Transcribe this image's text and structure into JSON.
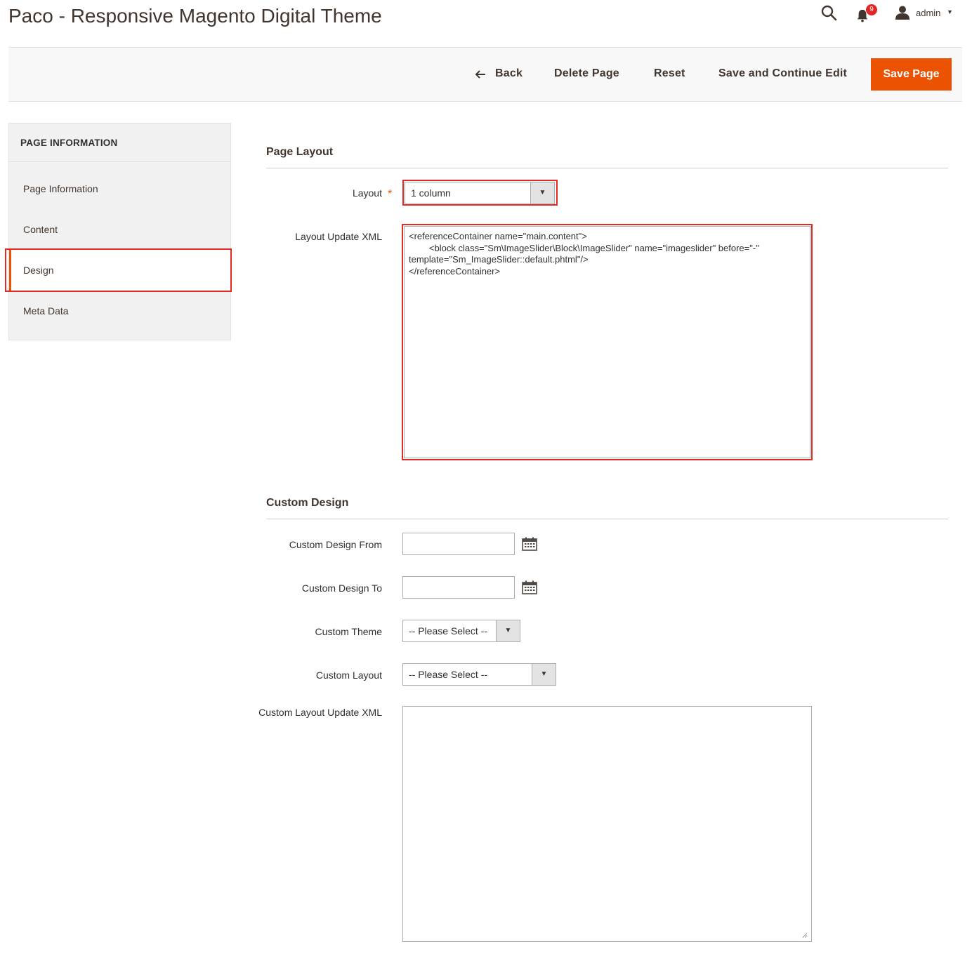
{
  "header": {
    "title": "Paco - Responsive Magento Digital Theme",
    "notifications_count": "9",
    "user_name": "admin"
  },
  "actions": {
    "back_label": "Back",
    "delete_label": "Delete Page",
    "reset_label": "Reset",
    "save_continue_label": "Save and Continue Edit",
    "save_label": "Save Page"
  },
  "sidebar": {
    "title": "PAGE INFORMATION",
    "items": [
      {
        "label": "Page Information",
        "active": false
      },
      {
        "label": "Content",
        "active": false
      },
      {
        "label": "Design",
        "active": true
      },
      {
        "label": "Meta Data",
        "active": false
      }
    ]
  },
  "page_layout": {
    "section_title": "Page Layout",
    "layout_label": "Layout",
    "layout_required_mark": "*",
    "layout_value": "1 column",
    "layout_xml_label": "Layout Update XML",
    "layout_xml_value": "<referenceContainer name=\"main.content\">\n        <block class=\"Sm\\ImageSlider\\Block\\ImageSlider\" name=\"imageslider\" before=\"-\" template=\"Sm_ImageSlider::default.phtml\"/>\n</referenceContainer>"
  },
  "custom_design": {
    "section_title": "Custom Design",
    "from_label": "Custom Design From",
    "from_value": "",
    "to_label": "Custom Design To",
    "to_value": "",
    "theme_label": "Custom Theme",
    "theme_value": "-- Please Select --",
    "layout_label": "Custom Layout",
    "layout_value": "-- Please Select --",
    "layout_xml_label": "Custom Layout Update XML",
    "layout_xml_value": ""
  },
  "colors": {
    "accent": "#eb5202",
    "highlight": "#e02b27",
    "badge": "#e22626"
  }
}
